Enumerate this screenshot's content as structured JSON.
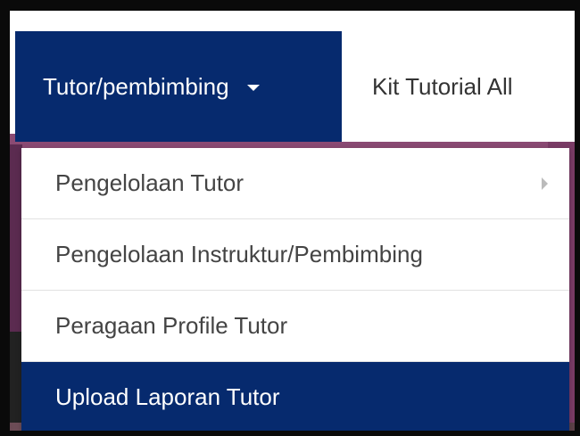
{
  "navbar": {
    "active_menu_label": "Tutor/pembimbing",
    "next_menu_label": "Kit Tutorial All"
  },
  "dropdown": {
    "items": [
      {
        "label": "Pengelolaan Tutor",
        "has_submenu": true
      },
      {
        "label": "Pengelolaan Instruktur/Pembimbing",
        "has_submenu": false
      },
      {
        "label": "Peragaan Profile Tutor",
        "has_submenu": false
      },
      {
        "label": "Upload Laporan Tutor",
        "has_submenu": false,
        "highlighted": true
      }
    ]
  },
  "colors": {
    "brand_navy": "#062a6e",
    "background_accent": "#8a4a73"
  },
  "icons": {
    "dropdown_caret": "caret-down-icon",
    "submenu_caret": "chevron-right-icon"
  }
}
